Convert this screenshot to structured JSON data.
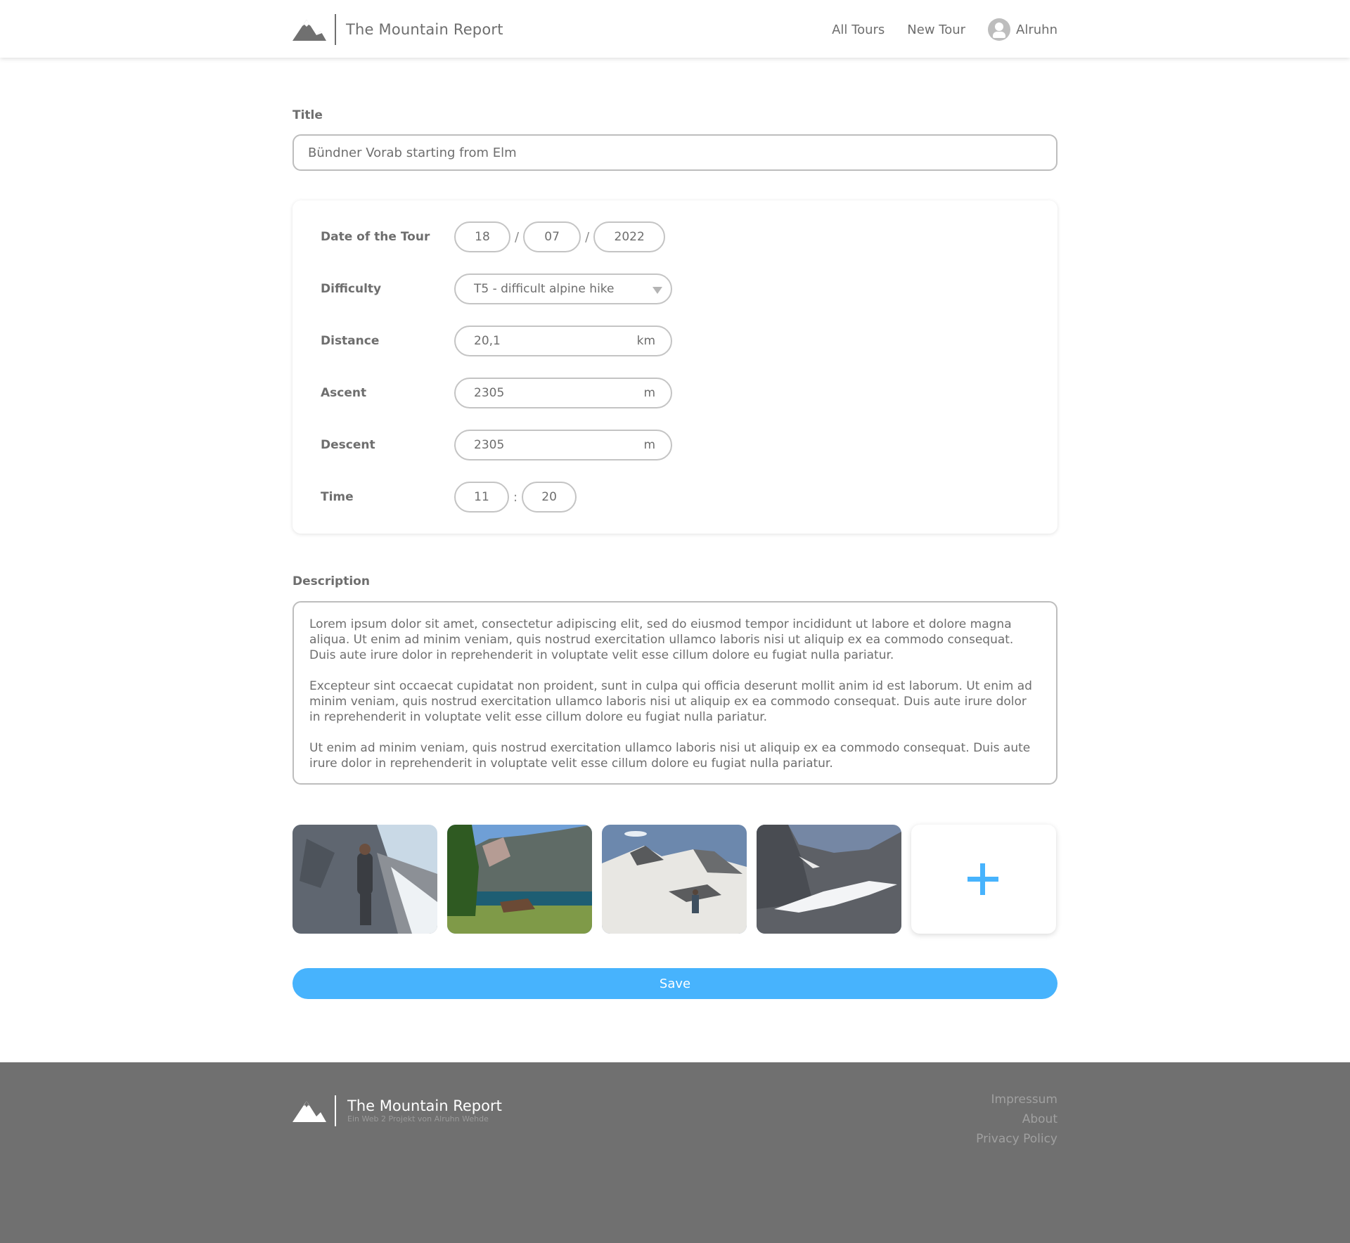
{
  "header": {
    "brand_name": "The Mountain Report",
    "nav": {
      "all_tours": "All Tours",
      "new_tour": "New Tour",
      "user_name": "Alruhn"
    }
  },
  "form": {
    "title": {
      "label": "Title",
      "value": "Bündner Vorab starting from Elm"
    },
    "details": {
      "date": {
        "label": "Date of the Tour",
        "day": "18",
        "month": "07",
        "year": "2022",
        "separator": "/"
      },
      "difficulty": {
        "label": "Difficulty",
        "selected": "T5 - difficult alpine hike"
      },
      "distance": {
        "label": "Distance",
        "value": "20,1",
        "unit": "km"
      },
      "ascent": {
        "label": "Ascent",
        "value": "2305",
        "unit": "m"
      },
      "descent": {
        "label": "Descent",
        "value": "2305",
        "unit": "m"
      },
      "time": {
        "label": "Time",
        "hours": "11",
        "minutes": "20",
        "separator": ":"
      }
    },
    "description": {
      "label": "Description",
      "paragraphs": [
        "Lorem ipsum dolor sit amet, consectetur adipiscing elit, sed do eiusmod tempor incididunt ut labore et dolore magna aliqua. Ut enim ad minim veniam, quis nostrud exercitation ullamco laboris nisi ut aliquip ex ea commodo consequat. Duis aute irure dolor in reprehenderit in voluptate velit esse cillum dolore eu fugiat nulla pariatur.",
        "Excepteur sint occaecat cupidatat non proident, sunt in culpa qui officia deserunt mollit anim id est laborum. Ut enim ad minim veniam, quis nostrud exercitation ullamco laboris nisi ut aliquip ex ea commodo consequat. Duis aute irure dolor in reprehenderit in voluptate velit esse cillum dolore eu fugiat nulla pariatur.",
        "Ut enim ad minim veniam, quis nostrud exercitation ullamco laboris nisi ut aliquip ex ea commodo consequat. Duis aute irure dolor in reprehenderit in voluptate velit esse cillum dolore eu fugiat nulla pariatur."
      ]
    },
    "photos": [
      {
        "subject": "hiker-on-rock-face"
      },
      {
        "subject": "lake-with-alpine-hut"
      },
      {
        "subject": "hiker-on-snowfield"
      },
      {
        "subject": "rocky-cirque-with-snow"
      }
    ],
    "add_photo_icon": "plus-icon",
    "save_label": "Save"
  },
  "footer": {
    "brand_name": "The Mountain Report",
    "tagline": "Ein Web 2 Projekt von Alruhn Wehde",
    "links": [
      "Impressum",
      "About",
      "Privacy Policy"
    ]
  },
  "colors": {
    "accent": "#47b3fd",
    "text": "#6e6e6e",
    "border": "#bdbdbd",
    "footer_bg": "#707070"
  }
}
